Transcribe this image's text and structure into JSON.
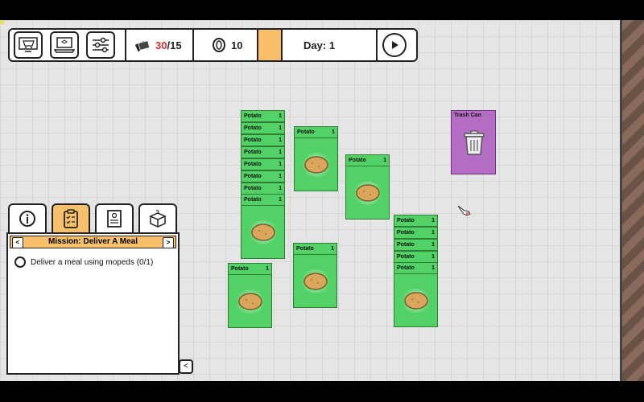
{
  "topbar": {
    "cards_current": "30",
    "cards_sep": "/",
    "cards_max": "15",
    "coins": "10",
    "day_label": "Day:",
    "day_value": "1"
  },
  "cards": {
    "potato_label": "Potato",
    "potato_count": "1",
    "trash_label": "Trash Can"
  },
  "mission": {
    "title": "Mission: Deliver A Meal",
    "prev": "<",
    "next": ">",
    "task": "Deliver a meal using mopeds (0/1)",
    "collapse": "<"
  },
  "colors": {
    "card_green": "#52d166",
    "trash_purple": "#b56dc4",
    "accent_orange": "#f8c06a",
    "alert_red": "#d23030"
  }
}
